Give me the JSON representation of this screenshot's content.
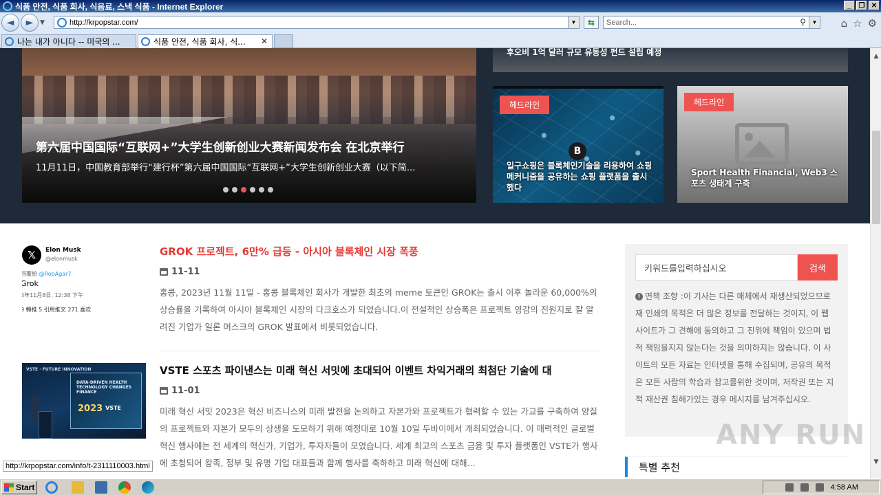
{
  "window": {
    "title": "식품 안전, 식품 회사, 식음료, 스낵 식품 - Internet Explorer",
    "min": "_",
    "restore": "❐",
    "close": "✕"
  },
  "browser": {
    "url": "http://krpopstar.com/",
    "search_placeholder": "Search...",
    "tabs": [
      {
        "label": "나는 내가 아니다 -- 미국의 ..."
      },
      {
        "label": "식품 안전, 식품 회사, 식..."
      }
    ],
    "status_url": "http://krpopstar.com/info/t-2311110003.html"
  },
  "hero": {
    "top_card_title": "후오비 1억 달러 규모 유동성 펀드 설립 예정",
    "slide": {
      "title": "第六届中国国际“互联网+”大学生创新创业大赛新闻发布会 在北京举行",
      "subtitle": "11月11日，中国教育部举行“建行杯”第六届中国国际“互联网+”大学生创新创业大赛（以下简...",
      "dots_total": 6,
      "active_dot": 3
    },
    "cards": [
      {
        "badge": "헤드라인",
        "title": "일구쇼핑은 블록체인기술을 리용하여 쇼핑 메커니즘을 공유하는 쇼핑 플랫폼을 출시했다",
        "coin": "B"
      },
      {
        "badge": "헤드라인",
        "title": "Sport Health Financial, Web3 스포츠 생태계 구축"
      }
    ]
  },
  "articles": [
    {
      "title": "GROK 프로젝트, 6만% 급등 - 아시아 블록체인 시장 폭풍",
      "date": "11-11",
      "body": "홍콩, 2023년 11월 11일 - 홍콩 블록체인 회사가 개발한 최초의 meme 토큰인 GROK는 출시 이후 놀라운 60,000%의 상승률을 기록하여 아시아 블록체인 시장의 다크호스가 되었습니다.이 전설적인 상승폭은 프로젝트 영감의 진원지로 잘 알려진 기업가 일론 머스크의 GROK 발표에서 비롯되었습니다.",
      "tweet": {
        "logo": "𝕏",
        "name": "Elon Musk",
        "handle": "@elonmusk",
        "reply_prefix": "回覆給",
        "reply_to": "@RobAgar7",
        "text": "Grok",
        "date": "3年11月8日, 12:38 下午",
        "stats": "9 轉推    5 引用推文    271 喜欢"
      }
    },
    {
      "title": "VSTE 스포츠 파이낸스는 미래 혁신 서밋에 초대되어 이벤트 차익거래의 최첨단 기술에 대",
      "date": "11-01",
      "body": "미래 혁신 서밋 2023은 혁신 비즈니스의 미래 발전을 논의하고 자본가와 프로젝트가 협력할 수 있는 가교를 구축하여 양질의 프로젝트와 자본가 모두의 상생을 도모하기 위해 예정대로 10월 10일 두바이에서 개최되었습니다. 이 매력적인 글로벌 혁신 행사에는 전 세계의 혁신가, 기업가, 투자자들이 모였습니다. 세계 최고의 스포츠 금융 및 투자 플랫폼인 VSTE가 행사에 초청되어 왕족, 정부 및 유명 기업 대표들과 함께 행사를 축하하고 미래 혁신에 대해...",
      "image": {
        "stage_text": "VSTE · FUTURE INNOVATION",
        "screen_text": "DATA-DRIVEN HEALTH TECHNOLOGY CHANGES FINANCE",
        "year": "2023",
        "brand": "VSTE"
      }
    }
  ],
  "sidebar": {
    "search_placeholder": "키워드를입력하십시오",
    "search_button": "검색",
    "disclaimer": "면책 조항 :이 기사는 다른 매체에서 재생산되었으므로 재 인쇄의 목적은 더 많은 정보를 전달하는 것이지, 이 웹 사이트가 그 견해에 동의하고 그 진위에 책임이 있으며 법적 책임을지지 않는다는 것을 의미하지는 않습니다. 이 사이트의 모든 자료는 인터넷을 통해 수집되며, 공유의 목적은 모든 사람의 학습과 참고를위한 것이며, 저작권 또는 지적 재산권 침해가있는 경우 메시지를 남겨주십시오.",
    "special_heading": "특별 추천"
  },
  "watermark": "ANY RUN",
  "taskbar": {
    "start": "Start",
    "clock": "4:58 AM"
  }
}
